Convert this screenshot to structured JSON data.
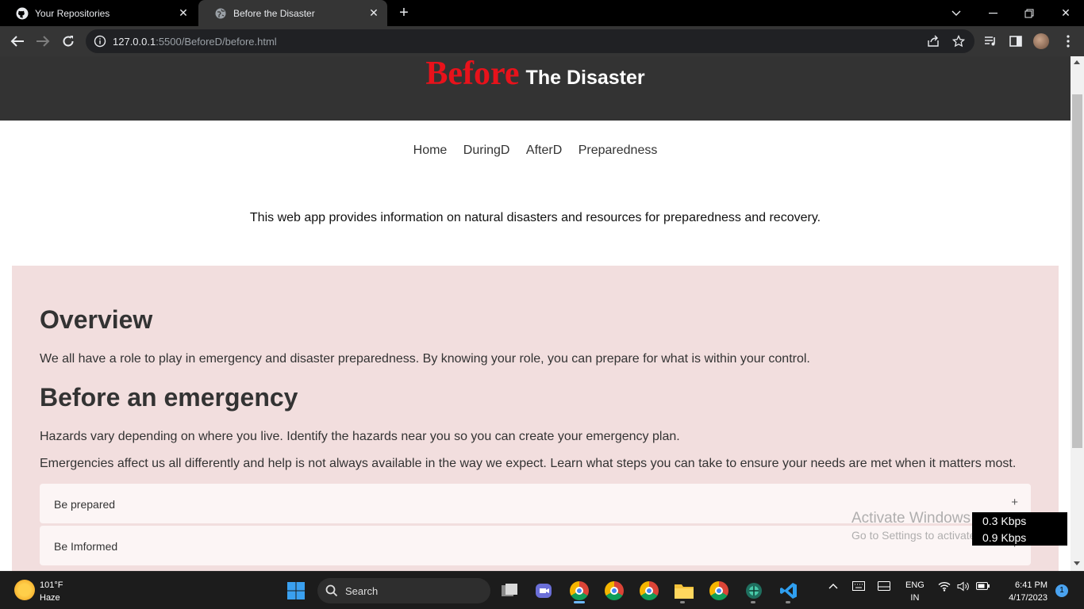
{
  "browser": {
    "tabs": [
      {
        "title": "Your Repositories",
        "icon": "github-icon",
        "active": false
      },
      {
        "title": "Before the Disaster",
        "icon": "globe-icon",
        "active": true
      }
    ],
    "url_host": "127.0.0.1",
    "url_rest": ":5500/BeforeD/before.html"
  },
  "page": {
    "brand_before": "Before",
    "brand_rest": "The Disaster",
    "nav": [
      "Home",
      "DuringD",
      "AfterD",
      "Preparedness"
    ],
    "intro": "This web app provides information on natural disasters and resources for preparedness and recovery.",
    "overview_heading": "Overview",
    "overview_text": "We all have a role to play in emergency and disaster preparedness. By knowing your role, you can prepare for what is within your control.",
    "before_heading": "Before an emergency",
    "before_text1": "Hazards vary depending on where you live. Identify the hazards near you so you can create your emergency plan.",
    "before_text2": "Emergencies affect us all differently and help is not always available in the way we expect. Learn what steps you can take to ensure your needs are met when it matters most.",
    "accordion": [
      {
        "label": "Be prepared",
        "toggle": "+"
      },
      {
        "label": "Be Imformed",
        "toggle": "+"
      }
    ],
    "colors": {
      "brand_red": "#e8121b",
      "header_bg": "#333333",
      "content_bg": "#f2dede"
    }
  },
  "overlay": {
    "activate_title": "Activate Windows",
    "activate_sub": "Go to Settings to activate Windows.",
    "net_up": "0.3 Kbps",
    "net_down": "0.9 Kbps"
  },
  "taskbar": {
    "temperature": "101°F",
    "weather": "Haze",
    "search_label": "Search",
    "lang1": "ENG",
    "lang2": "IN",
    "time": "6:41 PM",
    "date": "4/17/2023",
    "notification_count": "1"
  }
}
